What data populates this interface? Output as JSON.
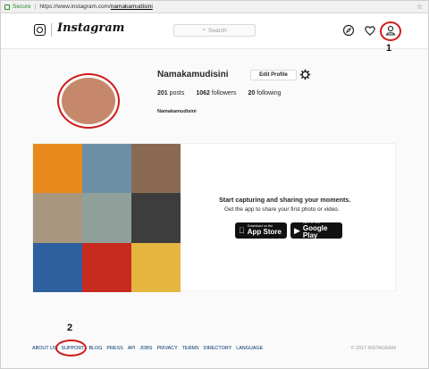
{
  "browser": {
    "secure_label": "Secure",
    "url_prefix": "https://www.instagram.com/",
    "url_account": "namakamudisini"
  },
  "header": {
    "wordmark": "Instagram",
    "search_placeholder": "Search"
  },
  "annotations": [
    "1",
    "2"
  ],
  "profile": {
    "username": "Namakamudisini",
    "edit_button": "Edit Profile",
    "posts_count": "201",
    "posts_label": "posts",
    "followers_count": "1062",
    "followers_label": "followers",
    "following_count": "20",
    "following_label": "following",
    "full_name": "Namakamudisini"
  },
  "empty_state": {
    "title": "Start capturing and sharing your moments.",
    "subtitle": "Get the app to share your first photo or video.",
    "app_store_small": "Download on the",
    "app_store_big": "App Store",
    "google_play_small": "GET IT ON",
    "google_play_big": "Google Play"
  },
  "footer": {
    "links": [
      "ABOUT US",
      "SUPPORT",
      "BLOG",
      "PRESS",
      "API",
      "JOBS",
      "PRIVACY",
      "TERMS",
      "DIRECTORY",
      "LANGUAGE"
    ],
    "copyright": "© 2017 INSTAGRAM"
  },
  "colors": {
    "annotation_red": "#d11a1a",
    "link_blue": "#003569",
    "avatar_fill": "#c5886a"
  },
  "mosaic_colors": [
    "#e8891c",
    "#6d8fa6",
    "#8a6a52",
    "#a8967e",
    "#8fa09a",
    "#3d3d3d",
    "#2e5f9e",
    "#c72a1f",
    "#e5b640"
  ]
}
